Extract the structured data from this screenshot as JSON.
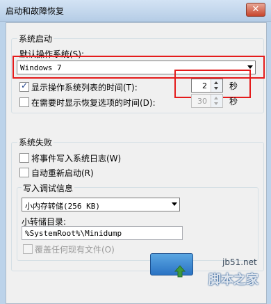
{
  "window": {
    "title": "启动和故障恢复",
    "close_glyph": "✕"
  },
  "system_startup": {
    "group_title": "系统启动",
    "default_os_label": "默认操作系统(S):",
    "default_os_value": "Windows 7",
    "show_os_list": {
      "label": "显示操作系统列表的时间(T):",
      "checked": true,
      "value": "2",
      "unit": "秒"
    },
    "show_recovery": {
      "label": "在需要时显示恢复选项的时间(D):",
      "checked": false,
      "value": "30",
      "unit": "秒"
    }
  },
  "system_failure": {
    "group_title": "系统失败",
    "write_event": {
      "label": "将事件写入系统日志(W)",
      "checked": false
    },
    "auto_restart": {
      "label": "自动重新启动(R)",
      "checked": false
    },
    "debug_info": {
      "group_title": "写入调试信息",
      "dump_type": "小内存转储(256 KB)",
      "dump_dir_label": "小转储目录:",
      "dump_dir_value": "%SystemRoot%\\Minidump",
      "overwrite": {
        "label": "覆盖任何现有文件(O)",
        "checked": false,
        "enabled": false
      }
    }
  },
  "watermark": {
    "site": "jb51.net",
    "brand": "脚本之家"
  },
  "colors": {
    "highlight_box": "#e41b1b",
    "titlebar": "#c5d9ee"
  }
}
